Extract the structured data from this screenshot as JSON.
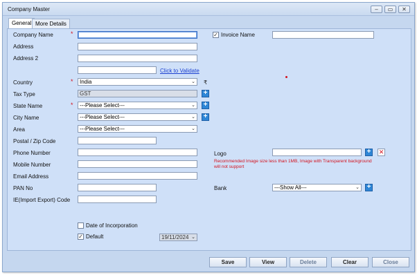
{
  "window": {
    "title": "Company Master",
    "controls": [
      "minimize-icon",
      "restore-icon",
      "close-icon"
    ]
  },
  "tabs": [
    {
      "label": "General",
      "active": true
    },
    {
      "label": "More Details",
      "active": false
    }
  ],
  "form": {
    "company_name": {
      "label": "Company Name",
      "value": ""
    },
    "address": {
      "label": "Address",
      "value": ""
    },
    "address2": {
      "label": "Address 2",
      "value": ""
    },
    "address3": {
      "value": ""
    },
    "validate_link": "Click to Validate",
    "country": {
      "label": "Country",
      "value": "India"
    },
    "currency_symbol": "₹",
    "tax_type": {
      "label": "Tax Type",
      "value": "GST"
    },
    "state": {
      "label": "State Name",
      "value": "---Please Select---"
    },
    "city": {
      "label": "City Name",
      "value": "---Please Select---"
    },
    "area": {
      "label": "Area",
      "value": "---Please Select---"
    },
    "zip": {
      "label": "Postal  / Zip Code",
      "value": ""
    },
    "phone": {
      "label": "Phone Number",
      "value": ""
    },
    "mobile": {
      "label": "Mobile Number",
      "value": ""
    },
    "email": {
      "label": "Email Address",
      "value": ""
    },
    "pan": {
      "label": "PAN No",
      "value": ""
    },
    "iec": {
      "label": "IE(Import Export) Code",
      "value": ""
    },
    "date_of_incorporation": {
      "label": "Date of Incorporation",
      "checked": false
    },
    "default": {
      "label": "Default",
      "checked": true
    },
    "date_value": "19/11/2024",
    "invoice_name": {
      "label": "Invoice Name",
      "checked": true,
      "value": ""
    },
    "logo": {
      "label": "Logo",
      "value": ""
    },
    "logo_note": "Recommended Image size less than 1MB, Image with Transparent background will not support",
    "bank": {
      "label": "Bank",
      "value": "---Show All---"
    }
  },
  "buttons": {
    "save": "Save",
    "view": "View",
    "delete": "Delete",
    "clear": "Clear",
    "close": "Close"
  },
  "colors": {
    "window_bg": "#c5d7ef",
    "panel_bg": "#cfe0f8",
    "required": "#d3121e",
    "link": "#1a3fd0",
    "plus_button": "#2e86d6"
  }
}
